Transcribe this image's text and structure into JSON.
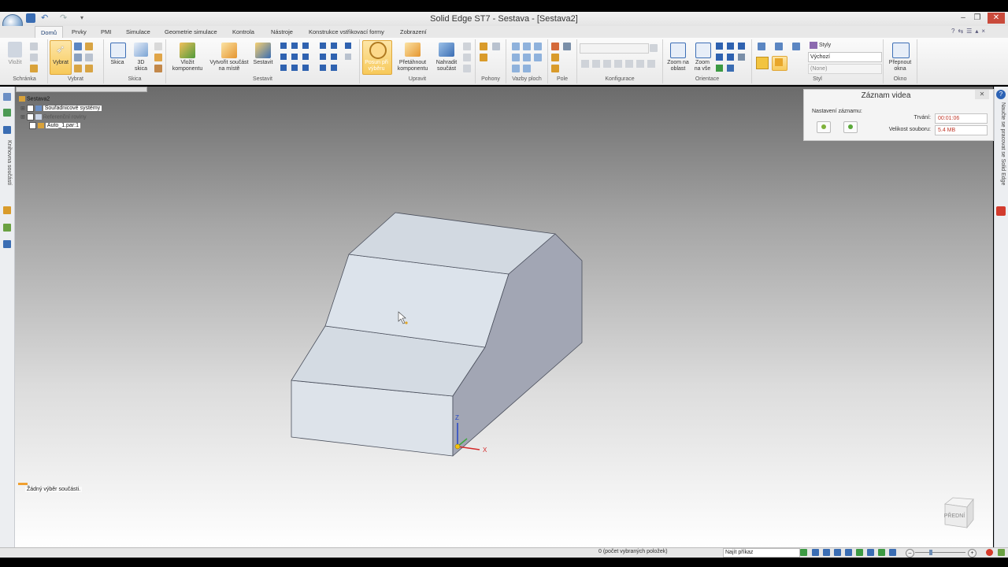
{
  "window": {
    "title": "Solid Edge ST7 - Sestava - [Sestava2]"
  },
  "tabs": [
    "Domů",
    "Prvky",
    "PMI",
    "Simulace",
    "Geometrie simulace",
    "Kontrola",
    "Nástroje",
    "Konstrukce vstřikovací formy",
    "Zobrazení"
  ],
  "ribbon": {
    "groups": [
      "Schránka",
      "Vybrat",
      "Skica",
      "Sestavit",
      "Upravit",
      "Pohony",
      "Vazby ploch",
      "Pole",
      "Konfigurace",
      "Orientace",
      "Styl",
      "Okno"
    ],
    "buttons": {
      "vlozit": "Vložit",
      "vybrat": "Vybrat",
      "skica": "Skica",
      "skica3d_1": "3D",
      "skica3d_2": "skica",
      "vlozit_komp_1": "Vložit",
      "vlozit_komp_2": "komponentu",
      "vytvorit_1": "Vytvořit součást",
      "vytvorit_2": "na místě",
      "sestavit": "Sestavit",
      "posun_1": "Posun při",
      "posun_2": "výběru",
      "pretahnout_1": "Přetáhnout",
      "pretahnout_2": "komponentu",
      "nahradit_1": "Nahradit",
      "nahradit_2": "součást",
      "zoom_oblast_1": "Zoom na",
      "zoom_oblast_2": "oblast",
      "zoom_vse_1": "Zoom",
      "zoom_vse_2": "na vše",
      "styly": "Styly",
      "prepnout_1": "Přepnout",
      "prepnout_2": "okna"
    },
    "style_select": "Výchozí",
    "style_none": "(None)"
  },
  "tree": {
    "root": "Sestava2",
    "items": [
      "Souřadnicové systémy",
      "Referenční roviny",
      "Auto_1.par:1"
    ]
  },
  "left_strip_label": "Knihovna součástí",
  "right_strip_label": "Naučte se pracovat se Solid Edge",
  "selection_msg": "Žádný výběr součásti.",
  "record_panel": {
    "title": "Záznam videa",
    "settings_label": "Nastavení záznamu:",
    "duration_label": "Trvání:",
    "duration_value": "00:01:06",
    "size_label": "Velikost souboru:",
    "size_value": "5.4 MB"
  },
  "view_cube_label": "PŘEDNÍ",
  "axes": {
    "x": "X",
    "z": "Z"
  },
  "status": {
    "selected_count": "0 (počet vybraných položek)",
    "command_search": "Najít příkaz"
  },
  "colors": {
    "accent": "#f7c95a",
    "face_light": "#dfe5ec",
    "face_dark": "#a2a6b4"
  }
}
